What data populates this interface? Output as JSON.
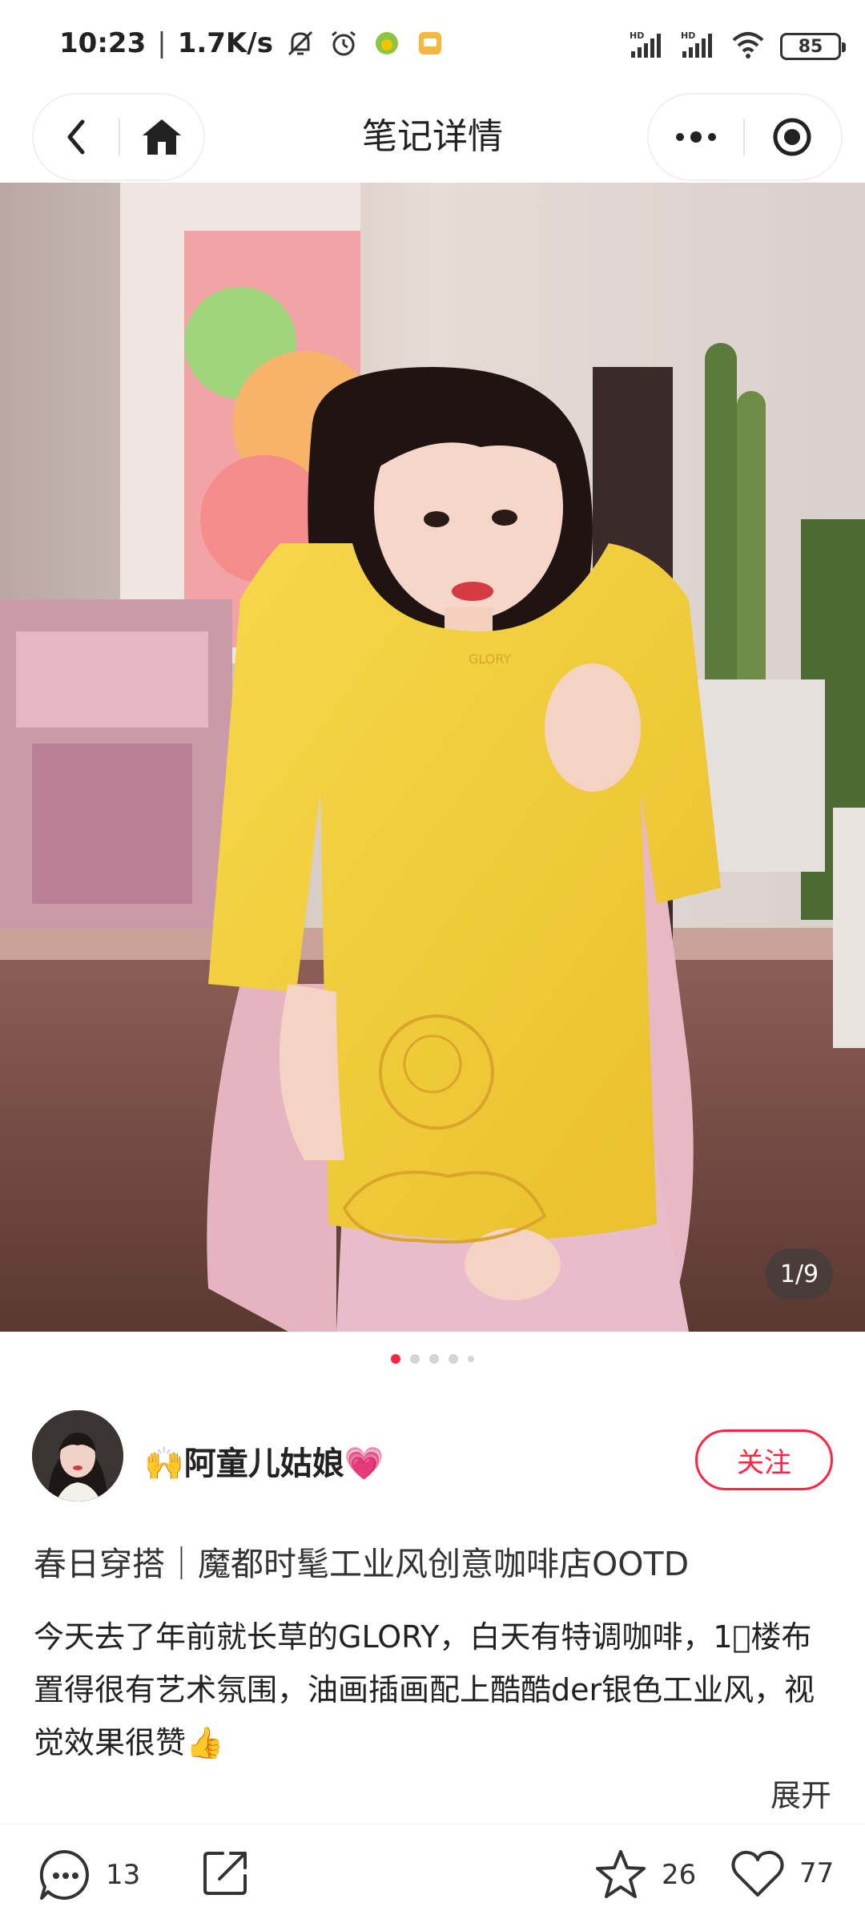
{
  "status_bar": {
    "time": "10:23",
    "separator": "|",
    "speed": "1.7K/s",
    "battery": "85"
  },
  "nav": {
    "title": "笔记详情"
  },
  "photo": {
    "counter": "1/9",
    "slides_total": 5,
    "active_slide": 1
  },
  "author": {
    "name": "🙌阿童儿姑娘💗",
    "follow_label": "关注"
  },
  "note": {
    "title": "春日穿搭｜魔都时髦工业风创意咖啡店OOTD",
    "body": "今天去了年前就长草的GLORY，白天有特调咖啡，1⃣楼布置得很有艺术氛围，油画插画配上酷酷der银色工业风，视觉效果很赞👍",
    "expand_label": "展开"
  },
  "bottom_bar": {
    "comment_count": "13",
    "star_count": "26",
    "like_count": "77"
  },
  "colors": {
    "accent": "#ff2442",
    "shirt": "#f2cf3a",
    "cardigan": "#e8b8c4"
  }
}
